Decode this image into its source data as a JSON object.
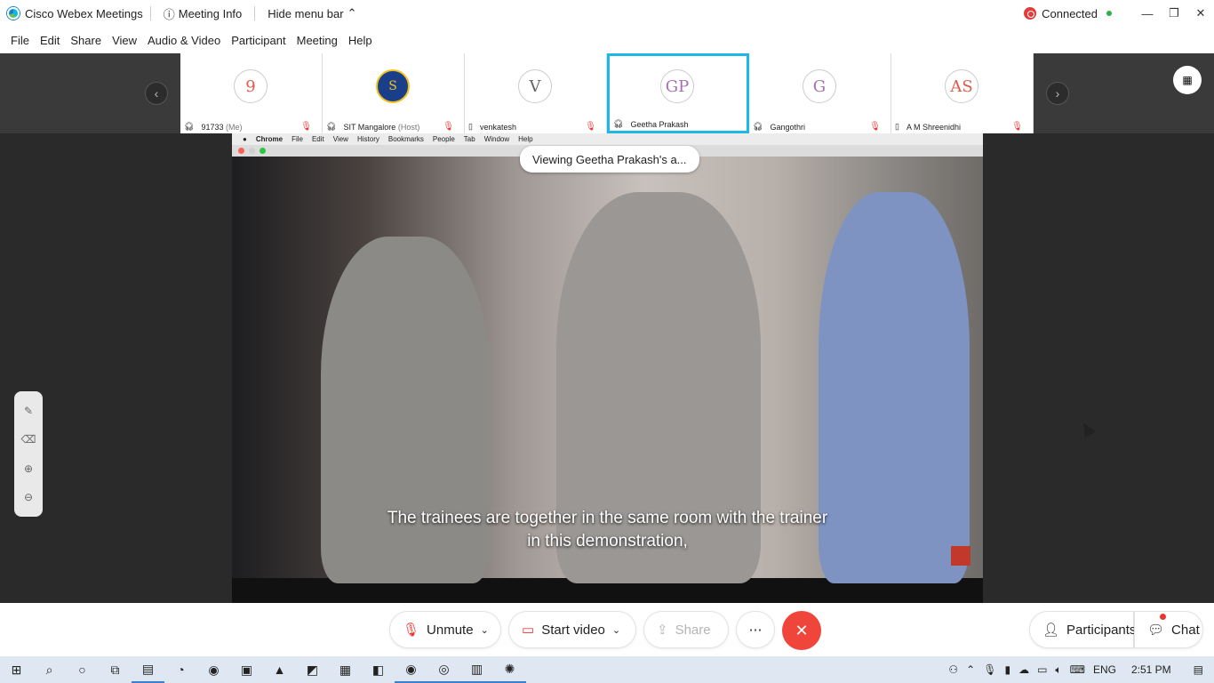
{
  "titlebar": {
    "app_name": "Cisco Webex Meetings",
    "meeting_info": "Meeting Info",
    "hide_menu": "Hide menu bar",
    "status": "Connected"
  },
  "menu": [
    "File",
    "Edit",
    "Share",
    "View",
    "Audio & Video",
    "Participant",
    "Meeting",
    "Help"
  ],
  "participants": [
    {
      "initials": "9",
      "name": "91733",
      "suffix": "(Me)",
      "color": "#e05a4f"
    },
    {
      "initials": "",
      "name": "SIT Mangalore",
      "suffix": "(Host)",
      "color": "#1a3e8a"
    },
    {
      "initials": "V",
      "name": "venkatesh",
      "suffix": "",
      "color": "#666666"
    },
    {
      "initials": "GP",
      "name": "Geetha Prakash",
      "suffix": "",
      "color": "#a76fb0"
    },
    {
      "initials": "G",
      "name": "Gangothri",
      "suffix": "",
      "color": "#a76fb0"
    },
    {
      "initials": "AS",
      "name": "A M Shreenidhi",
      "suffix": "",
      "color": "#e05a4f"
    }
  ],
  "mac_menu": [
    "Chrome",
    "File",
    "Edit",
    "View",
    "History",
    "Bookmarks",
    "People",
    "Tab",
    "Window",
    "Help"
  ],
  "viewing_label": "Viewing Geetha Prakash's a...",
  "caption_line1": "The trainees are together in the same room with the trainer",
  "caption_line2": "in this demonstration,",
  "controls": {
    "unmute": "Unmute",
    "start_video": "Start video",
    "share": "Share",
    "more": "⋯",
    "participants": "Participants",
    "chat": "Chat"
  },
  "taskbar": {
    "lang": "ENG",
    "time": "2:51 PM"
  }
}
